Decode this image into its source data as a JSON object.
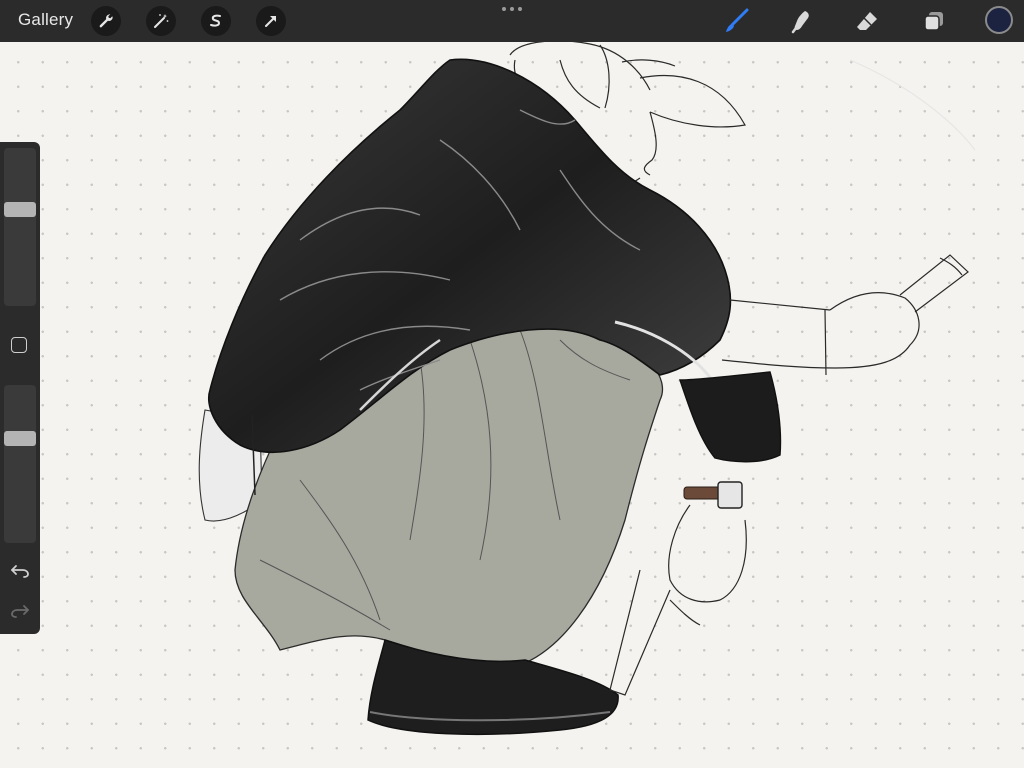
{
  "app": {
    "gallery_label": "Gallery",
    "accent_color": "#2f7cf6",
    "current_color": "#1c2340"
  },
  "toolbar_left": [
    {
      "name": "actions",
      "icon": "wrench-icon"
    },
    {
      "name": "adjustments",
      "icon": "magic-wand-icon"
    },
    {
      "name": "selection",
      "icon": "selection-s-icon"
    },
    {
      "name": "transform",
      "icon": "arrow-cursor-icon"
    }
  ],
  "toolbar_right": [
    {
      "name": "brush",
      "icon": "brush-icon",
      "active": true
    },
    {
      "name": "smudge",
      "icon": "smudge-finger-icon",
      "active": false
    },
    {
      "name": "eraser",
      "icon": "eraser-icon",
      "active": false
    },
    {
      "name": "layers",
      "icon": "layers-icon",
      "active": false
    },
    {
      "name": "colors",
      "icon": "color-swatch",
      "active": false
    }
  ],
  "sidebar": {
    "brush_size_level": 0.62,
    "opacity_level": 0.68,
    "controls": [
      "brush-size-slider",
      "modify-button",
      "opacity-slider",
      "undo-icon",
      "redo-icon"
    ]
  }
}
